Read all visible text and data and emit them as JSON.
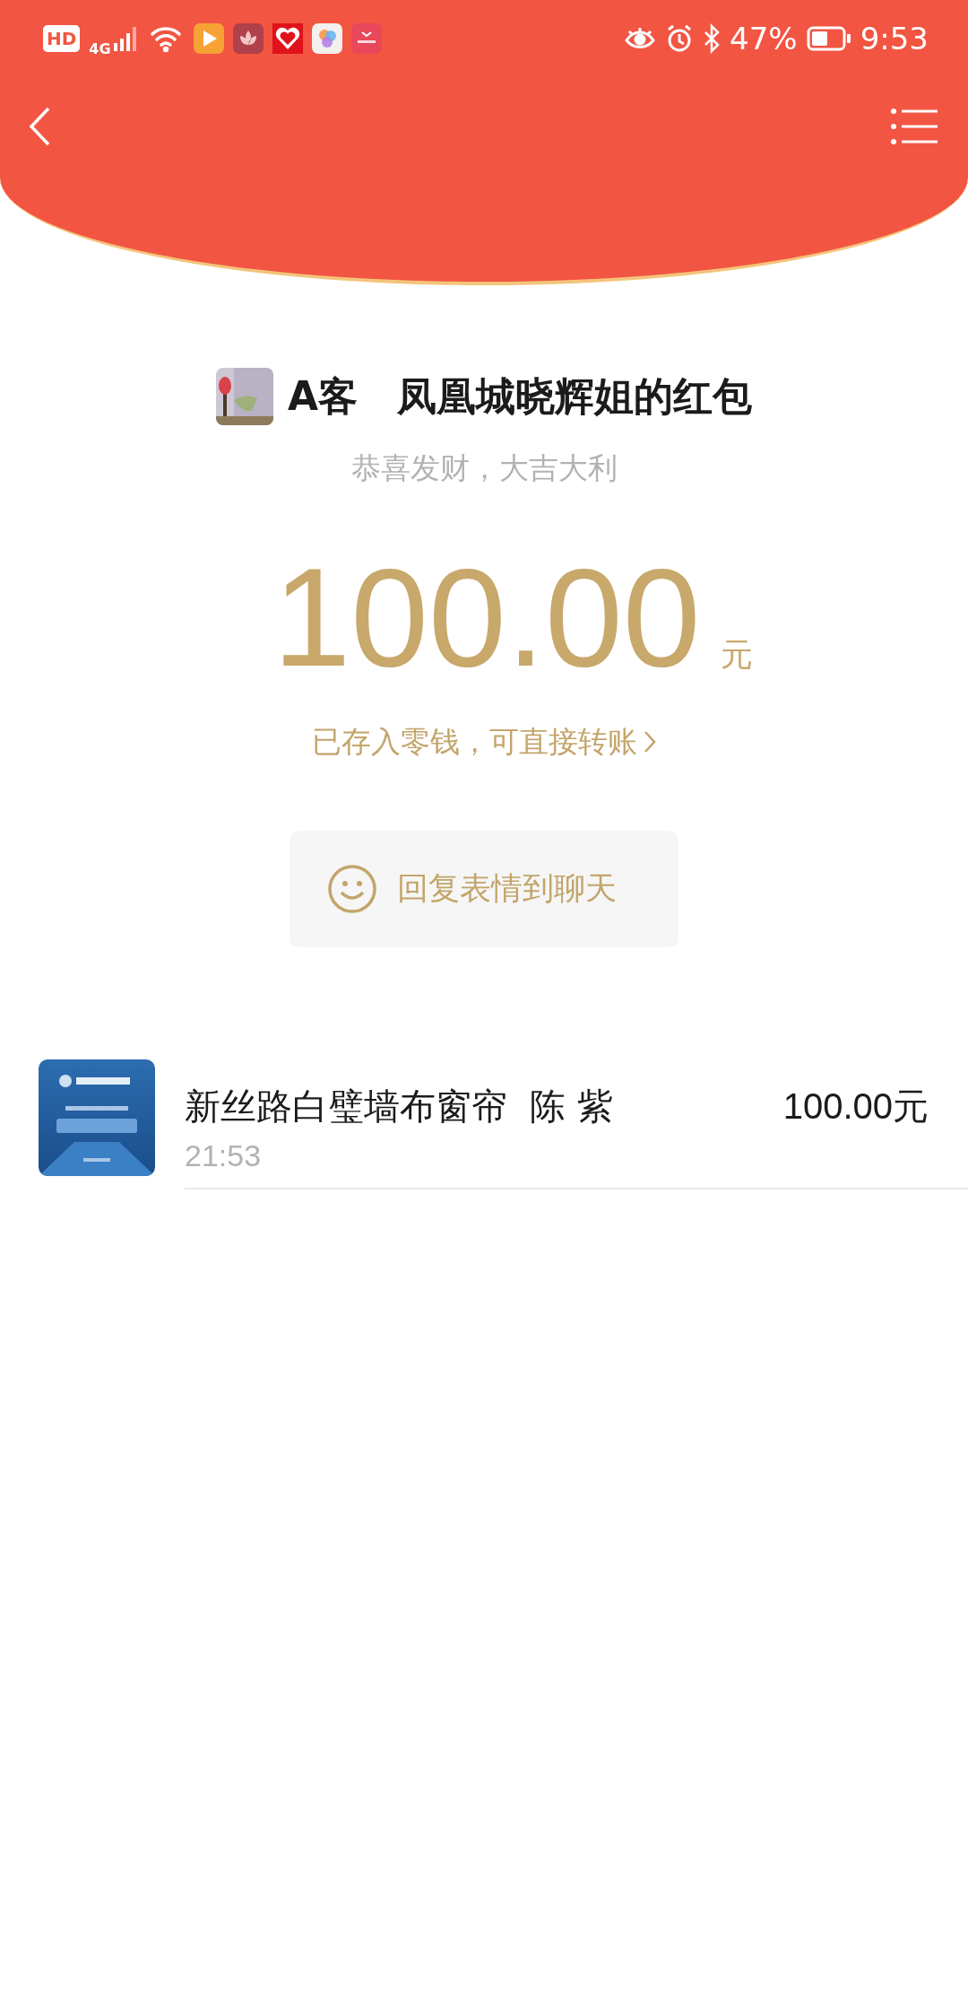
{
  "status_bar": {
    "network_labels": [
      "HD",
      "4G"
    ],
    "battery": "47%",
    "time": "9:53"
  },
  "packet": {
    "sender": "A客　凤凰城晓辉姐的红包",
    "greeting": "恭喜发财，大吉大利",
    "amount": "100.00",
    "unit": "元",
    "note": "已存入零钱，可直接转账",
    "reply_button": "回复表情到聊天"
  },
  "records": [
    {
      "name": "新丝路白璧墙布窗帘  陈 紫",
      "time": "21:53",
      "amount": "100.00元"
    }
  ]
}
